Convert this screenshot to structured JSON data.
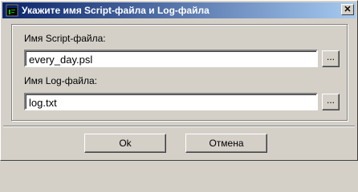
{
  "window": {
    "title": "Укажите имя Script-файла и Log-файла",
    "close_symbol": "✕",
    "icon": "terminal-app-icon"
  },
  "form": {
    "script_label": "Имя Script-файла:",
    "script_value": "every_day.psl",
    "script_browse": "...",
    "log_label": "Имя Log-файла:",
    "log_value": "log.txt",
    "log_browse": "..."
  },
  "buttons": {
    "ok": "Ok",
    "cancel": "Отмена"
  },
  "colors": {
    "title_start": "#0a246a",
    "title_end": "#a6caf0",
    "face": "#d4d0c8"
  }
}
